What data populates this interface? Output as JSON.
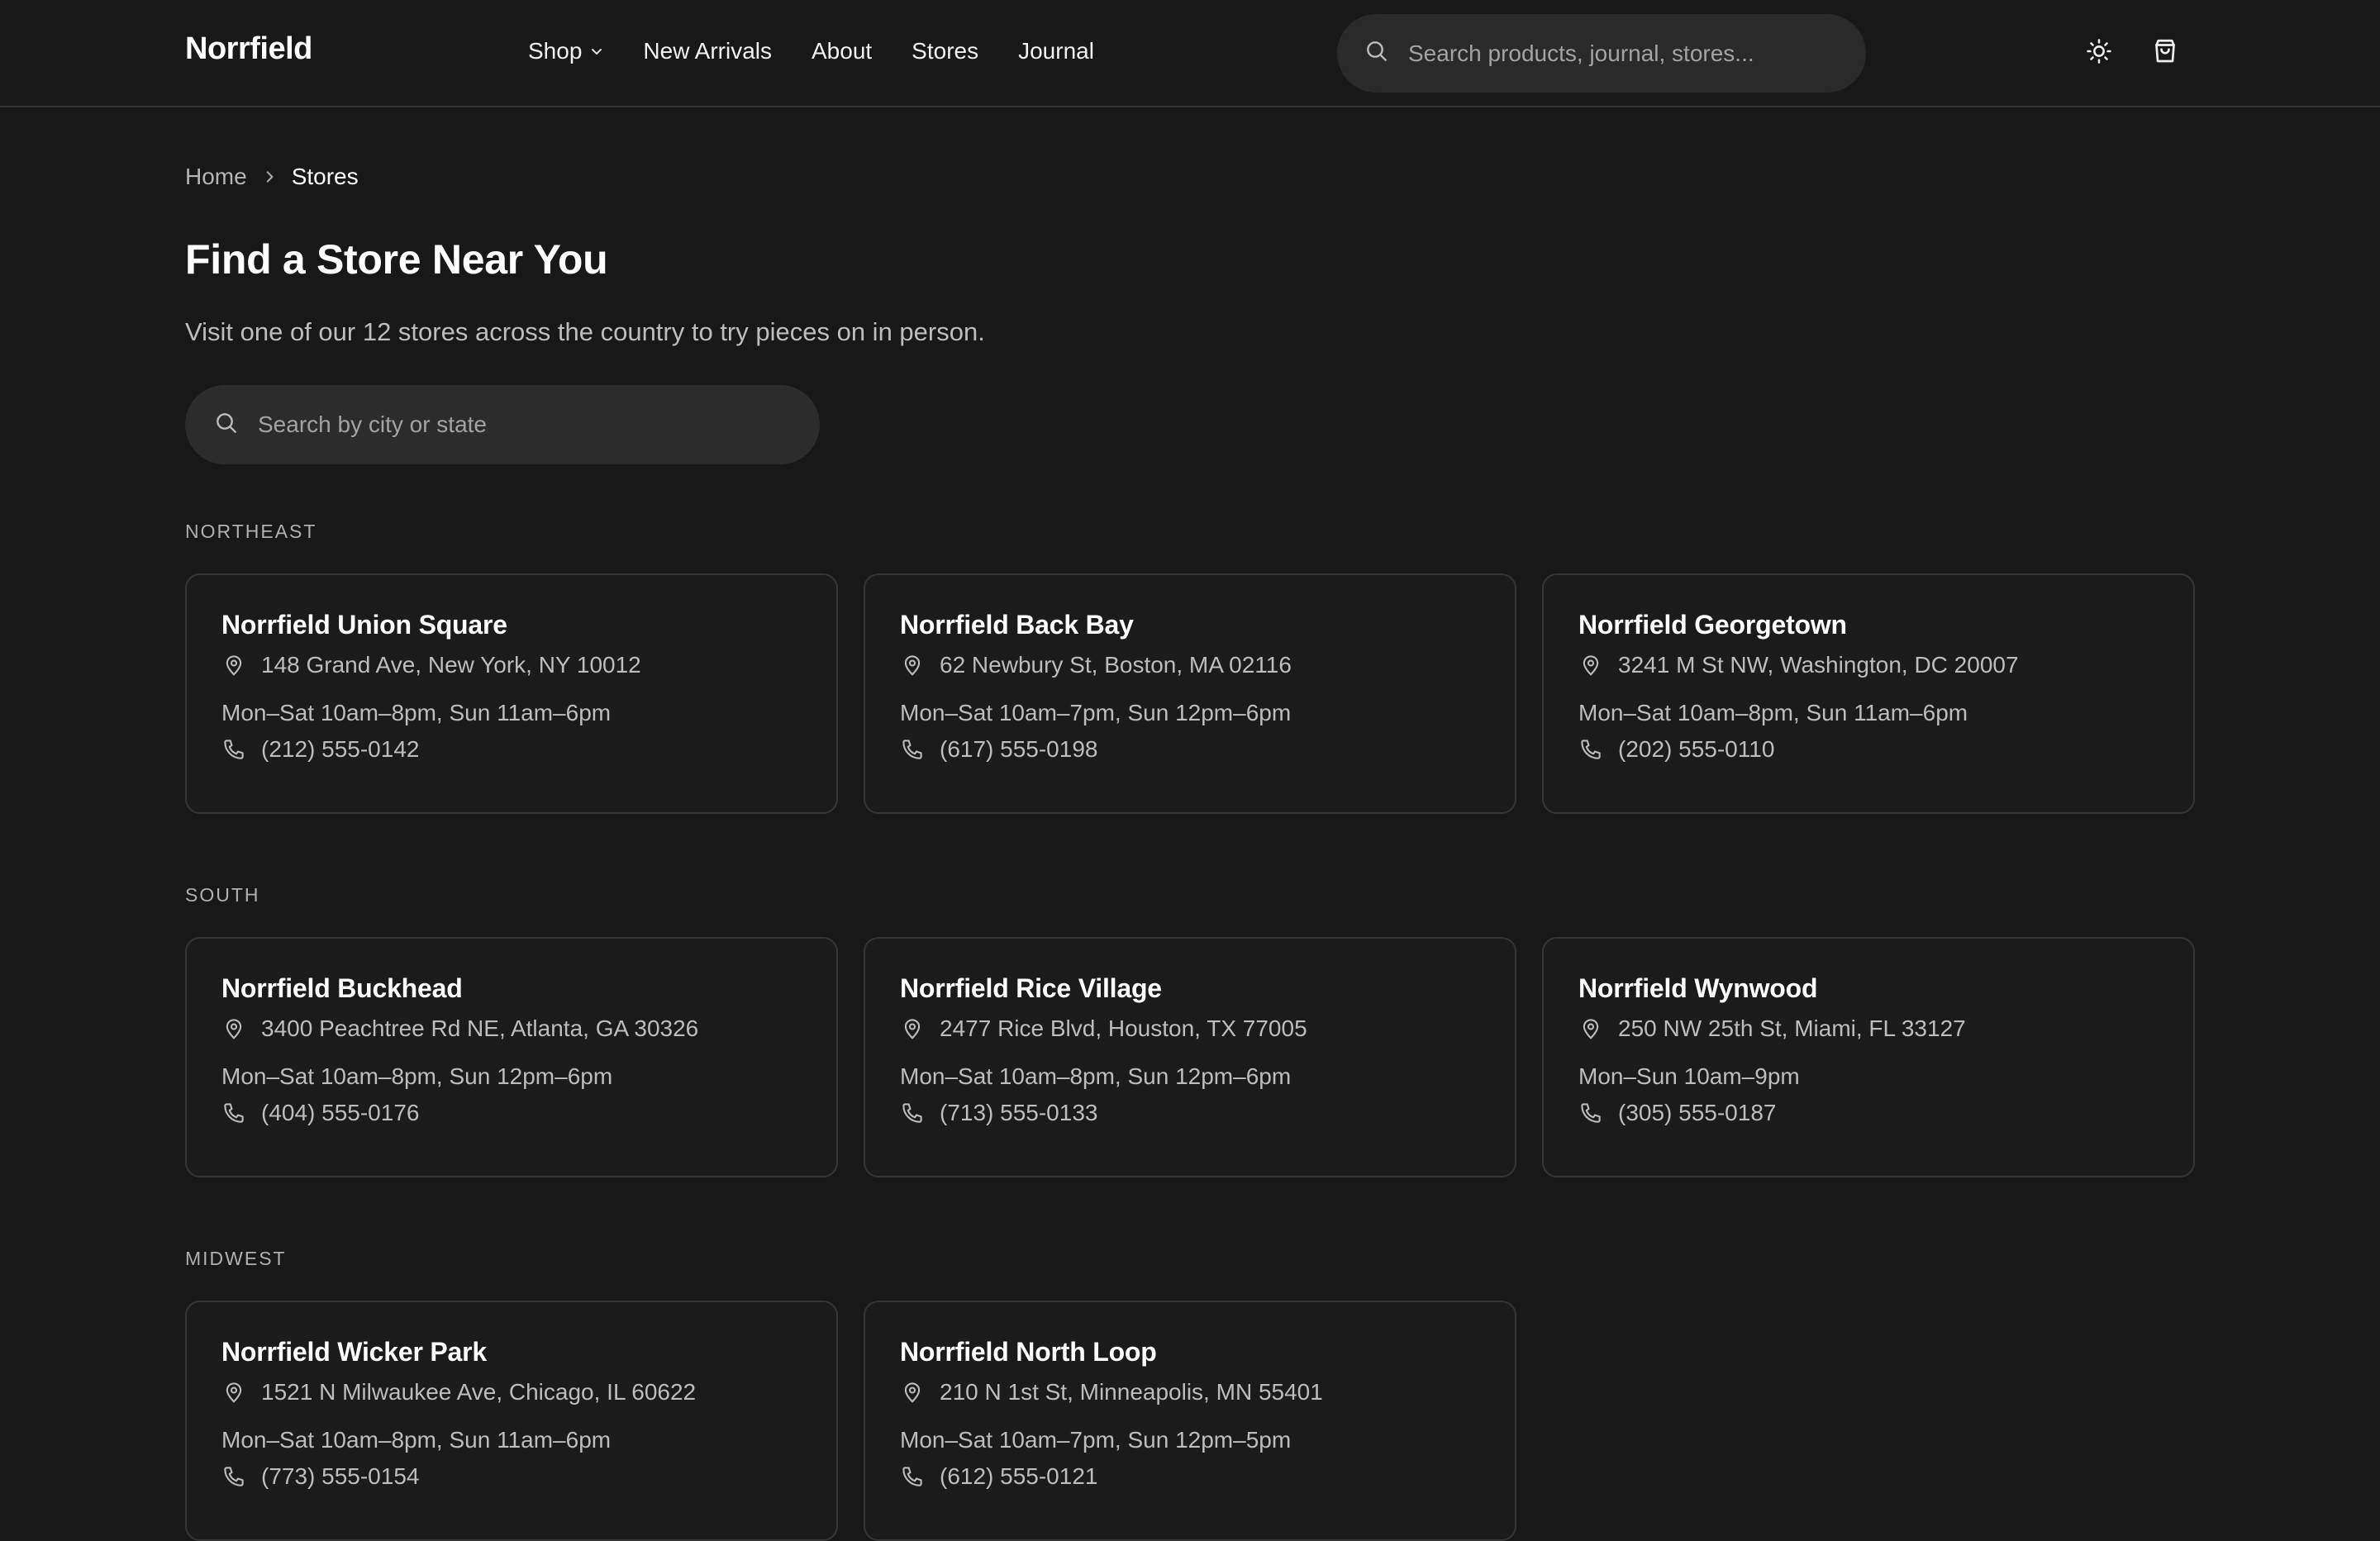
{
  "header": {
    "logo": "Norrfield",
    "nav": [
      {
        "label": "Shop"
      },
      {
        "label": "New Arrivals"
      },
      {
        "label": "About"
      },
      {
        "label": "Stores"
      },
      {
        "label": "Journal"
      }
    ],
    "search_placeholder": "Search products, journal, stores...",
    "icons": {
      "theme": "sun-icon",
      "cart": "shopping-bag-icon",
      "search": "search-icon"
    }
  },
  "breadcrumb": {
    "home": "Home",
    "current": "Stores"
  },
  "page": {
    "title": "Find a Store Near You",
    "subtitle": "Visit one of our 12 stores across the country to try pieces on in person.",
    "search_placeholder": "Search by city or state"
  },
  "regions": [
    {
      "label": "NORTHEAST",
      "stores": [
        {
          "name": "Norrfield Union Square",
          "address": "148 Grand Ave, New York, NY 10012",
          "hours": "Mon–Sat 10am–8pm, Sun 11am–6pm",
          "phone": "(212) 555-0142"
        },
        {
          "name": "Norrfield Back Bay",
          "address": "62 Newbury St, Boston, MA 02116",
          "hours": "Mon–Sat 10am–7pm, Sun 12pm–6pm",
          "phone": "(617) 555-0198"
        },
        {
          "name": "Norrfield Georgetown",
          "address": "3241 M St NW, Washington, DC 20007",
          "hours": "Mon–Sat 10am–8pm, Sun 11am–6pm",
          "phone": "(202) 555-0110"
        }
      ]
    },
    {
      "label": "SOUTH",
      "stores": [
        {
          "name": "Norrfield Buckhead",
          "address": "3400 Peachtree Rd NE, Atlanta, GA 30326",
          "hours": "Mon–Sat 10am–8pm, Sun 12pm–6pm",
          "phone": "(404) 555-0176"
        },
        {
          "name": "Norrfield Rice Village",
          "address": "2477 Rice Blvd, Houston, TX 77005",
          "hours": "Mon–Sat 10am–8pm, Sun 12pm–6pm",
          "phone": "(713) 555-0133"
        },
        {
          "name": "Norrfield Wynwood",
          "address": "250 NW 25th St, Miami, FL 33127",
          "hours": "Mon–Sun 10am–9pm",
          "phone": "(305) 555-0187"
        }
      ]
    },
    {
      "label": "MIDWEST",
      "stores": [
        {
          "name": "Norrfield Wicker Park",
          "address": "1521 N Milwaukee Ave, Chicago, IL 60622",
          "hours": "Mon–Sat 10am–8pm, Sun 11am–6pm",
          "phone": "(773) 555-0154"
        },
        {
          "name": "Norrfield North Loop",
          "address": "210 N 1st St, Minneapolis, MN 55401",
          "hours": "Mon–Sat 10am–7pm, Sun 12pm–5pm",
          "phone": "(612) 555-0121"
        }
      ]
    }
  ]
}
